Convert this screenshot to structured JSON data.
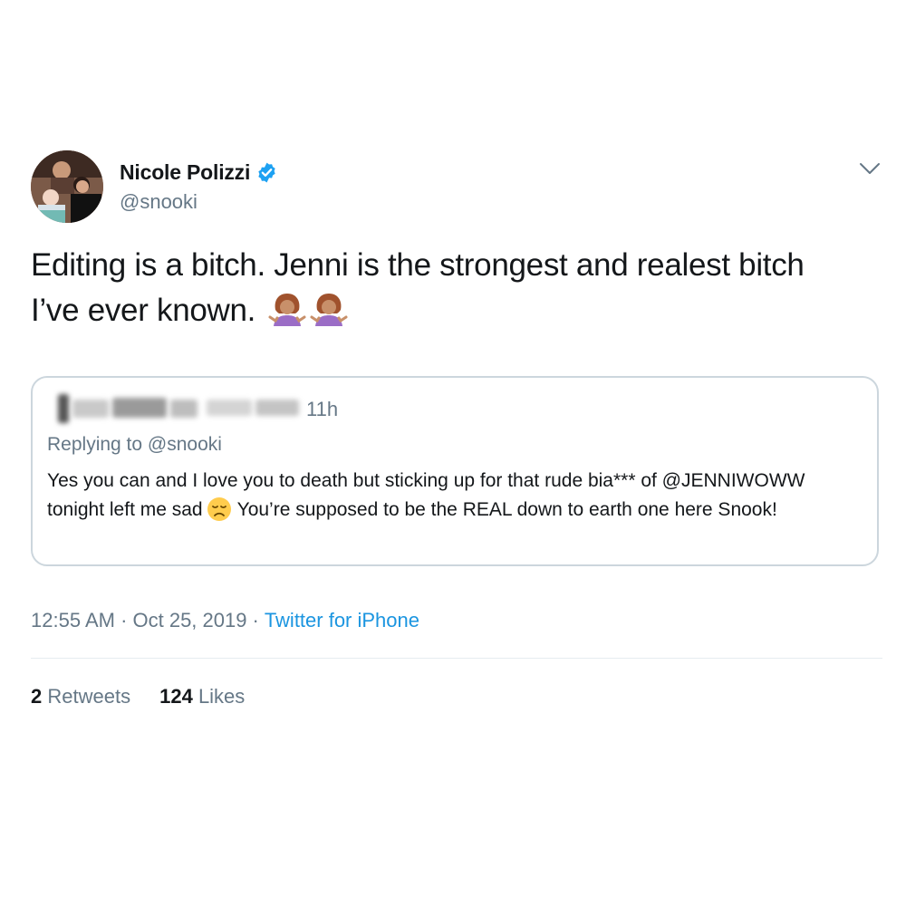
{
  "user": {
    "display_name": "Nicole Polizzi",
    "handle": "@snooki",
    "verified": true
  },
  "tweet": {
    "text_line1": "Editing is a bitch. Jenni is the strongest and realest bitch",
    "text_line2": "I’ve ever known.",
    "emojis": [
      "woman-shrugging-emoji",
      "woman-shrugging-emoji"
    ],
    "timestamp": "12:55 AM · Oct 25, 2019",
    "separator": "·",
    "source": "Twitter for iPhone"
  },
  "quoted_tweet": {
    "time": "11h",
    "replying_to": "Replying to @snooki",
    "text_part1": "Yes you can and I love you to death but sticking up for that rude bia*** of @JENNIWOWW tonight left me sad",
    "text_part2": "You’re supposed to be the REAL down to earth one here Snook!",
    "emoji": "disappointed-face-emoji"
  },
  "stats": {
    "retweets_count": "2",
    "retweets_label": "Retweets",
    "likes_count": "124",
    "likes_label": "Likes"
  },
  "colors": {
    "link": "#1b95e0",
    "secondary_text": "#657786",
    "border": "#ccd6dd",
    "verified": "#1da1f2"
  }
}
